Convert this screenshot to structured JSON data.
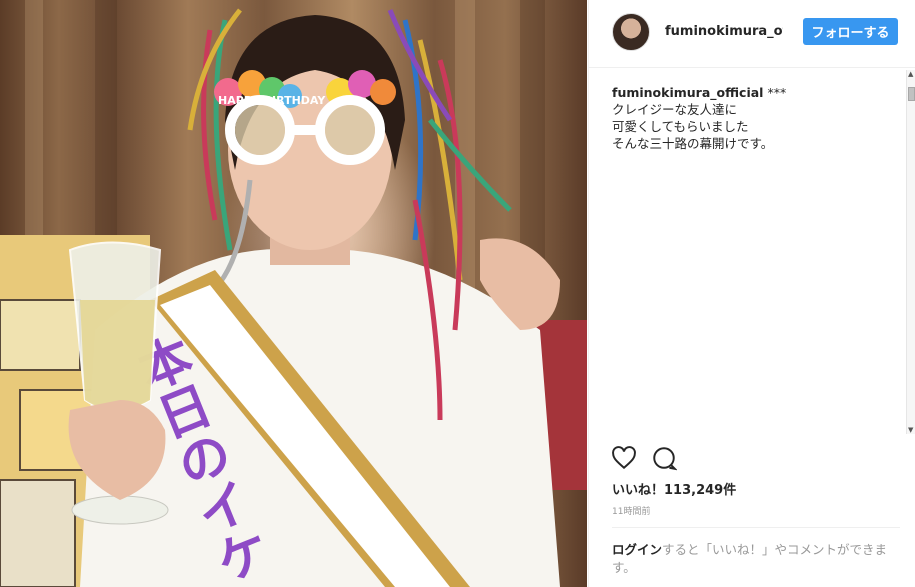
{
  "post": {
    "username": "fuminokimura_official",
    "follow_label": "フォローする",
    "caption": {
      "user": "fuminokimura_official",
      "mark": "***",
      "lines": [
        "クレイジーな友人達に",
        "可愛くしてもらいました",
        "そんな三十路の幕開けです。"
      ]
    },
    "likes": "いいね！113,249件",
    "time": "11時間前",
    "login_prompt": {
      "link": "ログイン",
      "text": "すると「いいね！」やコメントができます。"
    }
  },
  "photo": {
    "glasses_text": "HAPPY BIRTHDAY",
    "sash_text": "本日のイケ"
  },
  "icons": {
    "like": "heart-icon",
    "comment": "comment-bubble-icon"
  },
  "colors": {
    "follow_button": "#3897f0",
    "text": "#262626",
    "muted": "#999999",
    "divider": "#efefef",
    "sash": "#8e4bc6",
    "tinsel": "#c93a5a"
  }
}
